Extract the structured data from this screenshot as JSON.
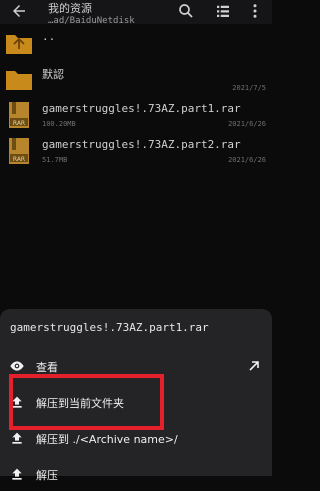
{
  "topbar": {
    "title": "我的资源",
    "path": "…ad/BaiduNetdisk"
  },
  "files": [
    {
      "type": "folder",
      "name": "..",
      "size": "",
      "time": ""
    },
    {
      "type": "folder",
      "name": "默認",
      "size": "",
      "time": "2021/7/5"
    },
    {
      "type": "rar",
      "name": "gamerstruggles!.73AZ.part1.rar",
      "size": "100.20MB",
      "time": "2021/6/26"
    },
    {
      "type": "rar",
      "name": "gamerstruggles!.73AZ.part2.rar",
      "size": "51.7MB",
      "time": "2021/6/26"
    }
  ],
  "sheet": {
    "title": "gamerstruggles!.73AZ.part1.rar",
    "actions": [
      {
        "icon": "eye-icon",
        "label": "查看"
      },
      {
        "icon": "extract-icon",
        "label": "解压到当前文件夹"
      },
      {
        "icon": "extract-icon",
        "label": "解压到 ./<Archive name>/"
      },
      {
        "icon": "extract-icon",
        "label": "解压"
      }
    ]
  },
  "colors": {
    "background": "#0b0b0c",
    "sheet": "#242427",
    "folder": "#c98a1c",
    "highlight": "#e5202a"
  }
}
